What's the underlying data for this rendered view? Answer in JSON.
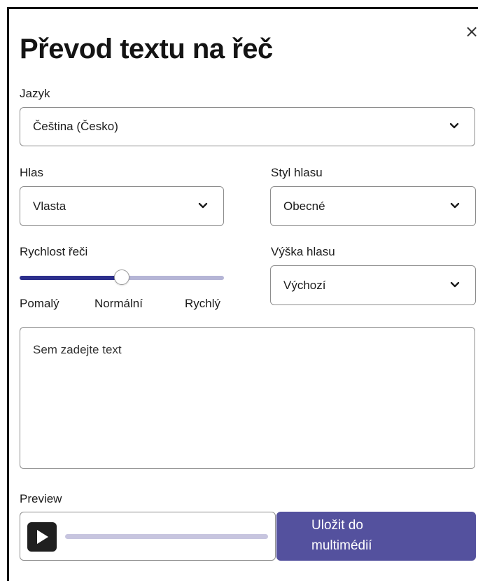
{
  "dialog": {
    "title": "Převod textu na řeč",
    "close_glyph": "×"
  },
  "language": {
    "label": "Jazyk",
    "value": "Čeština (Česko)"
  },
  "voice": {
    "label": "Hlas",
    "value": "Vlasta"
  },
  "voice_style": {
    "label": "Styl hlasu",
    "value": "Obecné"
  },
  "speech_rate": {
    "label": "Rychlost řeči",
    "value_fraction": 0.5,
    "tick_slow": "Pomalý",
    "tick_normal": "Normální",
    "tick_fast": "Rychlý"
  },
  "pitch": {
    "label": "Výška hlasu",
    "value": "Výchozí"
  },
  "text_input": {
    "placeholder": "Sem zadejte text"
  },
  "preview": {
    "label": "Preview",
    "progress_fraction": 0.0
  },
  "save": {
    "label_line1": "Uložit do",
    "label_line2": "multimédií"
  },
  "icons": {
    "close": "close-icon",
    "dropdown": "chevron-down-icon",
    "play": "play-icon"
  },
  "colors": {
    "accent": "#54519e",
    "slider_fill": "#2c2f8c",
    "slider_track": "#b5b5d6",
    "progress_track": "#c7c5df"
  }
}
